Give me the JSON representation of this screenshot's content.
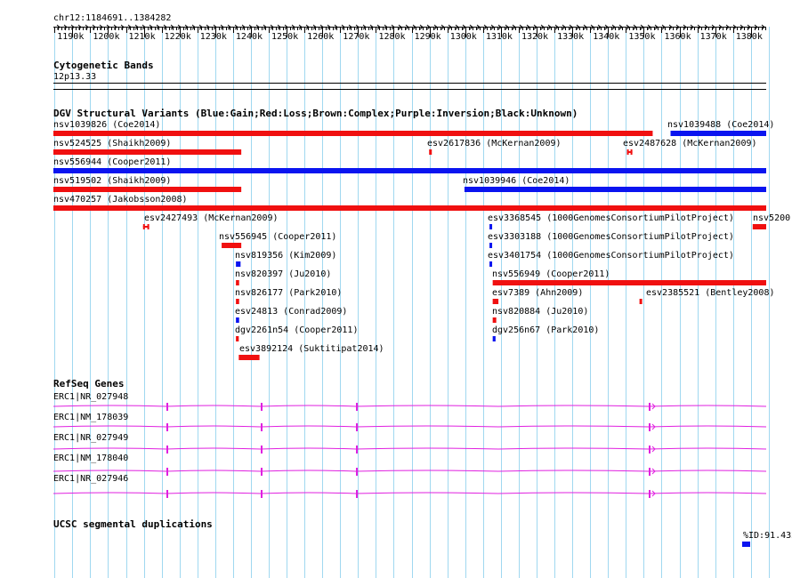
{
  "position": "chr12:1184691..1384282",
  "ruler": {
    "ticks": [
      "1190k",
      "1200k",
      "1210k",
      "1220k",
      "1230k",
      "1240k",
      "1250k",
      "1260k",
      "1270k",
      "1280k",
      "1290k",
      "1300k",
      "1310k",
      "1320k",
      "1330k",
      "1340k",
      "1350k",
      "1360k",
      "1370k",
      "1380k"
    ]
  },
  "tracks": {
    "cytoband": {
      "title": "Cytogenetic Bands",
      "band": "12p13.33"
    },
    "dgv": {
      "title": "DGV Structural Variants (Blue:Gain;Red:Loss;Brown:Complex;Purple:Inversion;Black:Unknown)"
    },
    "refseq": {
      "title": "RefSeq Genes"
    },
    "segdup": {
      "title": "UCSC segmental duplications",
      "label": "%ID:91.432"
    }
  },
  "colors": {
    "gain": "#0a14f0",
    "loss": "#f01010",
    "gene": "#e020e0",
    "grid": "#a0d8f0"
  },
  "variants": [
    {
      "label": "nsv1039826 (Coe2014)",
      "type": "loss",
      "start": 1184691,
      "end": 1352500
    },
    {
      "label": "nsv1039488 (Coe2014)",
      "type": "gain",
      "start": 1357500,
      "end": 1384282
    },
    {
      "label": "nsv524525 (Shaikh2009)",
      "type": "loss",
      "start": 1184691,
      "end": 1237300
    },
    {
      "label": "esv2617836 (McKernan2009)",
      "type": "loss",
      "start": 1289900,
      "end": 1290300
    },
    {
      "label": "esv2487628 (McKernan2009)",
      "type": "loss",
      "start": 1345300,
      "end": 1346800
    },
    {
      "label": "nsv556944 (Cooper2011)",
      "type": "gain",
      "start": 1184691,
      "end": 1384282
    },
    {
      "label": "nsv519502 (Shaikh2009)",
      "type": "loss",
      "start": 1184691,
      "end": 1237300
    },
    {
      "label": "nsv1039946 (Coe2014)",
      "type": "gain",
      "start": 1299800,
      "end": 1384282
    },
    {
      "label": "nsv470257 (Jakobsson2008)",
      "type": "loss",
      "start": 1184691,
      "end": 1384282
    },
    {
      "label": "esv2427493 (McKernan2009)",
      "type": "loss",
      "start": 1209800,
      "end": 1211500
    },
    {
      "label": "esv3368545 (1000GenomesConsortiumPilotProject)",
      "type": "gain",
      "start": 1306800,
      "end": 1307200
    },
    {
      "label": "nsv5200",
      "type": "loss",
      "start": 1380500,
      "end": 1384282
    },
    {
      "label": "nsv556945 (Cooper2011)",
      "type": "loss",
      "start": 1231800,
      "end": 1237300
    },
    {
      "label": "esv3303188 (1000GenomesConsortiumPilotProject)",
      "type": "gain",
      "start": 1306800,
      "end": 1307200
    },
    {
      "label": "nsv819356 (Kim2009)",
      "type": "gain",
      "start": 1235800,
      "end": 1237100
    },
    {
      "label": "esv3401754 (1000GenomesConsortiumPilotProject)",
      "type": "gain",
      "start": 1306800,
      "end": 1307200
    },
    {
      "label": "nsv820397 (Ju2010)",
      "type": "loss",
      "start": 1235800,
      "end": 1236700
    },
    {
      "label": "nsv556949 (Cooper2011)",
      "type": "loss",
      "start": 1307700,
      "end": 1384282
    },
    {
      "label": "nsv826177 (Park2010)",
      "type": "loss",
      "start": 1235800,
      "end": 1236700
    },
    {
      "label": "esv7389 (Ahn2009)",
      "type": "loss",
      "start": 1307700,
      "end": 1309300
    },
    {
      "label": "esv2385521 (Bentley2008)",
      "type": "loss",
      "start": 1348800,
      "end": 1349200
    },
    {
      "label": "esv24813 (Conrad2009)",
      "type": "gain",
      "start": 1235800,
      "end": 1236700
    },
    {
      "label": "nsv820884 (Ju2010)",
      "type": "loss",
      "start": 1307700,
      "end": 1308700
    },
    {
      "label": "dgv2261n54 (Cooper2011)",
      "type": "loss",
      "start": 1235800,
      "end": 1236600
    },
    {
      "label": "dgv256n67 (Park2010)",
      "type": "gain",
      "start": 1307700,
      "end": 1308500
    },
    {
      "label": "esv3892124 (Suktitipat2014)",
      "type": "loss",
      "start": 1236600,
      "end": 1242400
    }
  ],
  "genes": [
    {
      "label": "ERC1|NR_027948"
    },
    {
      "label": "ERC1|NM_178039"
    },
    {
      "label": "ERC1|NR_027949"
    },
    {
      "label": "ERC1|NM_178040"
    },
    {
      "label": "ERC1|NR_027946"
    }
  ]
}
